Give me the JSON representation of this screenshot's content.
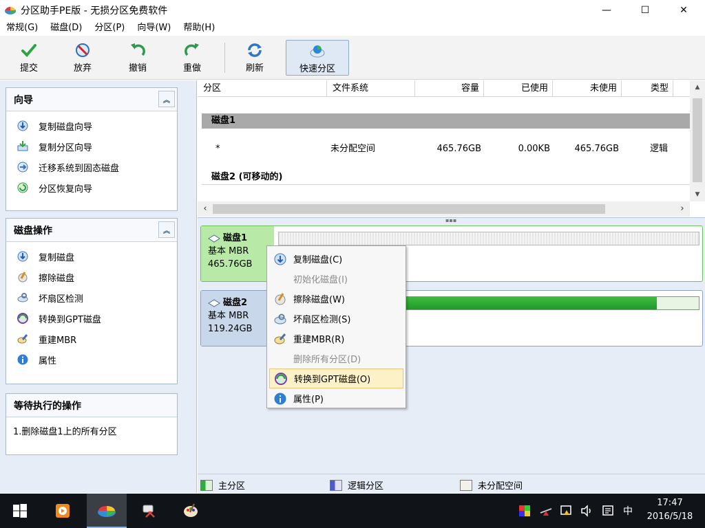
{
  "window": {
    "title": "分区助手PE版 - 无损分区免费软件",
    "min": "—",
    "max": "☐",
    "close": "✕"
  },
  "menu": [
    "常规(G)",
    "磁盘(D)",
    "分区(P)",
    "向导(W)",
    "帮助(H)"
  ],
  "toolbar": {
    "commit": "提交",
    "discard": "放弃",
    "undo": "撤销",
    "redo": "重做",
    "refresh": "刷新",
    "quick_partition": "快速分区"
  },
  "wizard_panel": {
    "title": "向导",
    "items": [
      "复制磁盘向导",
      "复制分区向导",
      "迁移系统到固态磁盘",
      "分区恢复向导"
    ]
  },
  "disk_ops_panel": {
    "title": "磁盘操作",
    "items": [
      "复制磁盘",
      "擦除磁盘",
      "坏扇区检测",
      "转换到GPT磁盘",
      "重建MBR",
      "属性"
    ]
  },
  "pending_panel": {
    "title": "等待执行的操作",
    "items": [
      "1.删除磁盘1上的所有分区"
    ]
  },
  "table": {
    "columns": [
      "分区",
      "文件系统",
      "容量",
      "已使用",
      "未使用",
      "类型"
    ],
    "disk1_label": "磁盘1",
    "row": {
      "partition": "*",
      "fs": "未分配空间",
      "capacity": "465.76GB",
      "used": "0.00KB",
      "free": "465.76GB",
      "type": "逻辑"
    },
    "disk2_label": "磁盘2 (可移动的)"
  },
  "disks": [
    {
      "name": "磁盘1",
      "type": "基本 MBR",
      "size": "465.76GB"
    },
    {
      "name": "磁盘2",
      "type": "基本 MBR",
      "size": "119.24GB",
      "used_fraction": 0.9
    }
  ],
  "legend": {
    "primary": "主分区",
    "logical": "逻辑分区",
    "unallocated": "未分配空间"
  },
  "context_menu": [
    {
      "label": "复制磁盘(C)",
      "disabled": false
    },
    {
      "label": "初始化磁盘(I)",
      "disabled": true
    },
    {
      "label": "擦除磁盘(W)",
      "disabled": false
    },
    {
      "label": "坏扇区检测(S)",
      "disabled": false
    },
    {
      "label": "重建MBR(R)",
      "disabled": false
    },
    {
      "label": "删除所有分区(D)",
      "disabled": true
    },
    {
      "label": "转换到GPT磁盘(O)",
      "disabled": false,
      "highlighted": true
    },
    {
      "label": "属性(P)",
      "disabled": false
    }
  ],
  "taskbar": {
    "time": "17:47",
    "date": "2016/5/18",
    "ime": "中"
  },
  "colors": {
    "primary": "#2eae3a",
    "logical": "#4a5bd0",
    "unallocated": "#f2f2ea",
    "accent": "#8db2e0"
  }
}
